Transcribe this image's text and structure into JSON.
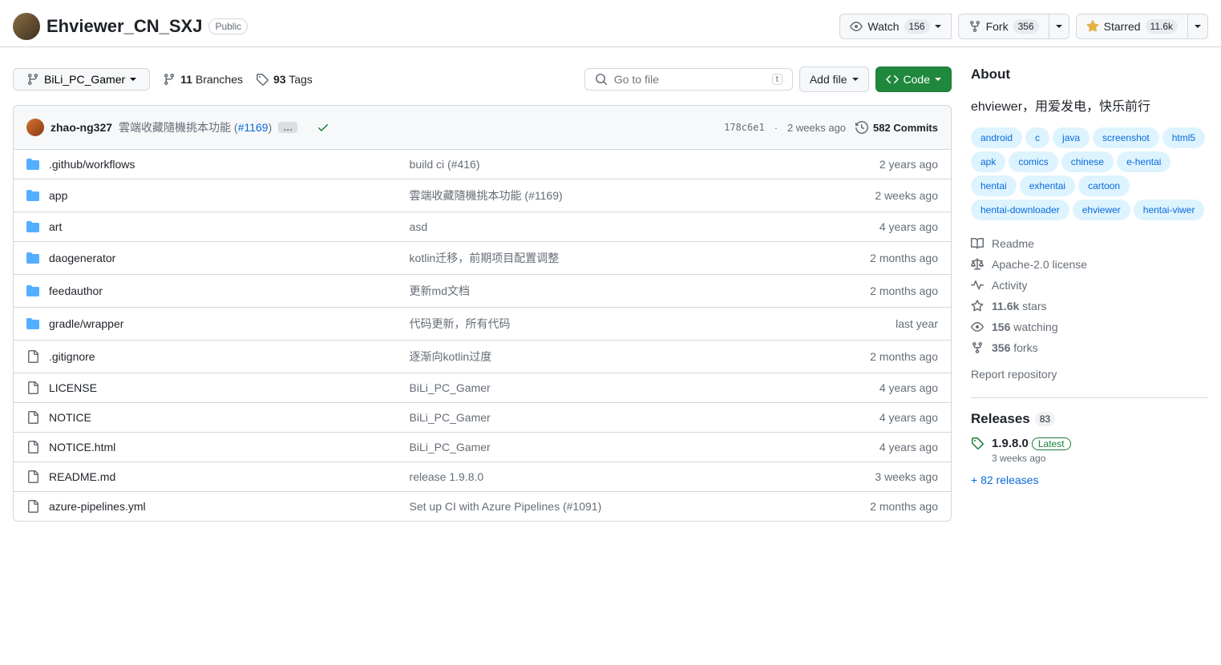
{
  "header": {
    "repo_name": "Ehviewer_CN_SXJ",
    "visibility": "Public",
    "watch_label": "Watch",
    "watch_count": "156",
    "fork_label": "Fork",
    "fork_count": "356",
    "star_label": "Starred",
    "star_count": "11.6k"
  },
  "toolbar": {
    "branch": "BiLi_PC_Gamer",
    "branches_count": "11",
    "branches_label": "Branches",
    "tags_count": "93",
    "tags_label": "Tags",
    "search_placeholder": "Go to file",
    "search_kbd": "t",
    "addfile_label": "Add file",
    "code_label": "Code"
  },
  "commit": {
    "author": "zhao-ng327",
    "message": "雲端收藏隨機挑本功能 (",
    "pr_link": "#1169",
    "message_close": ")",
    "sha": "178c6e1",
    "time": "2 weeks ago",
    "commits_count": "582",
    "commits_label": "Commits"
  },
  "files": [
    {
      "type": "dir",
      "name": ".github/workflows",
      "msg": "build ci (",
      "link": "#416",
      "msg_close": ")",
      "date": "2 years ago"
    },
    {
      "type": "dir",
      "name": "app",
      "msg": "雲端收藏隨機挑本功能 (",
      "link": "#1169",
      "msg_close": ")",
      "date": "2 weeks ago"
    },
    {
      "type": "dir",
      "name": "art",
      "msg": "asd",
      "link": "",
      "msg_close": "",
      "date": "4 years ago"
    },
    {
      "type": "dir",
      "name": "daogenerator",
      "msg": "kotlin迁移，前期项目配置调整",
      "link": "",
      "msg_close": "",
      "date": "2 months ago"
    },
    {
      "type": "dir",
      "name": "feedauthor",
      "msg": "更新md文档",
      "link": "",
      "msg_close": "",
      "date": "2 months ago"
    },
    {
      "type": "dir",
      "name": "gradle/wrapper",
      "msg": "代码更新，所有代码",
      "link": "",
      "msg_close": "",
      "date": "last year"
    },
    {
      "type": "file",
      "name": ".gitignore",
      "msg": "逐渐向kotlin过度",
      "link": "",
      "msg_close": "",
      "date": "2 months ago"
    },
    {
      "type": "file",
      "name": "LICENSE",
      "msg": "BiLi_PC_Gamer",
      "link": "",
      "msg_close": "",
      "date": "4 years ago"
    },
    {
      "type": "file",
      "name": "NOTICE",
      "msg": "BiLi_PC_Gamer",
      "link": "",
      "msg_close": "",
      "date": "4 years ago"
    },
    {
      "type": "file",
      "name": "NOTICE.html",
      "msg": "BiLi_PC_Gamer",
      "link": "",
      "msg_close": "",
      "date": "4 years ago"
    },
    {
      "type": "file",
      "name": "README.md",
      "msg": "release 1.9.8.0",
      "link": "",
      "msg_close": "",
      "date": "3 weeks ago"
    },
    {
      "type": "file",
      "name": "azure-pipelines.yml",
      "msg": "Set up CI with Azure Pipelines (",
      "link": "#1091",
      "msg_close": ")",
      "date": "2 months ago"
    }
  ],
  "about": {
    "title": "About",
    "description": "ehviewer，用爱发电，快乐前行",
    "topics": [
      "android",
      "c",
      "java",
      "screenshot",
      "html5",
      "apk",
      "comics",
      "chinese",
      "e-hentai",
      "hentai",
      "exhentai",
      "cartoon",
      "hentai-downloader",
      "ehviewer",
      "hentai-viwer"
    ],
    "readme": "Readme",
    "license": "Apache-2.0 license",
    "activity": "Activity",
    "stars_count": "11.6k",
    "stars_label": "stars",
    "watching_count": "156",
    "watching_label": "watching",
    "forks_count": "356",
    "forks_label": "forks",
    "report": "Report repository"
  },
  "releases": {
    "title": "Releases",
    "count": "83",
    "latest_name": "1.9.8.0",
    "latest_badge": "Latest",
    "latest_date": "3 weeks ago",
    "more": "+ 82 releases"
  }
}
